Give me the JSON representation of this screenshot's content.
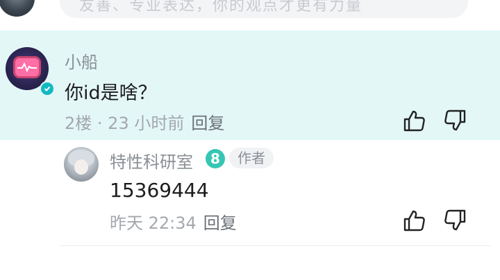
{
  "top_input": {
    "placeholder": "友善、专业表达，你的观点才更有力量"
  },
  "main_comment": {
    "username": "小船",
    "text": "你id是啥？",
    "floor": "2楼",
    "separator": " · ",
    "time": "23 小时前",
    "reply_label": "回复",
    "verified_icon": "check-badge-icon"
  },
  "reply_comment": {
    "username": "特性科研室",
    "level": "8",
    "author_tag": "作者",
    "text": "15369444",
    "time": "昨天 22:34",
    "reply_label": "回复"
  },
  "colors": {
    "highlight": "#e3f7f7",
    "accent": "#14b8c4",
    "level_badge": "#36c6b4"
  }
}
